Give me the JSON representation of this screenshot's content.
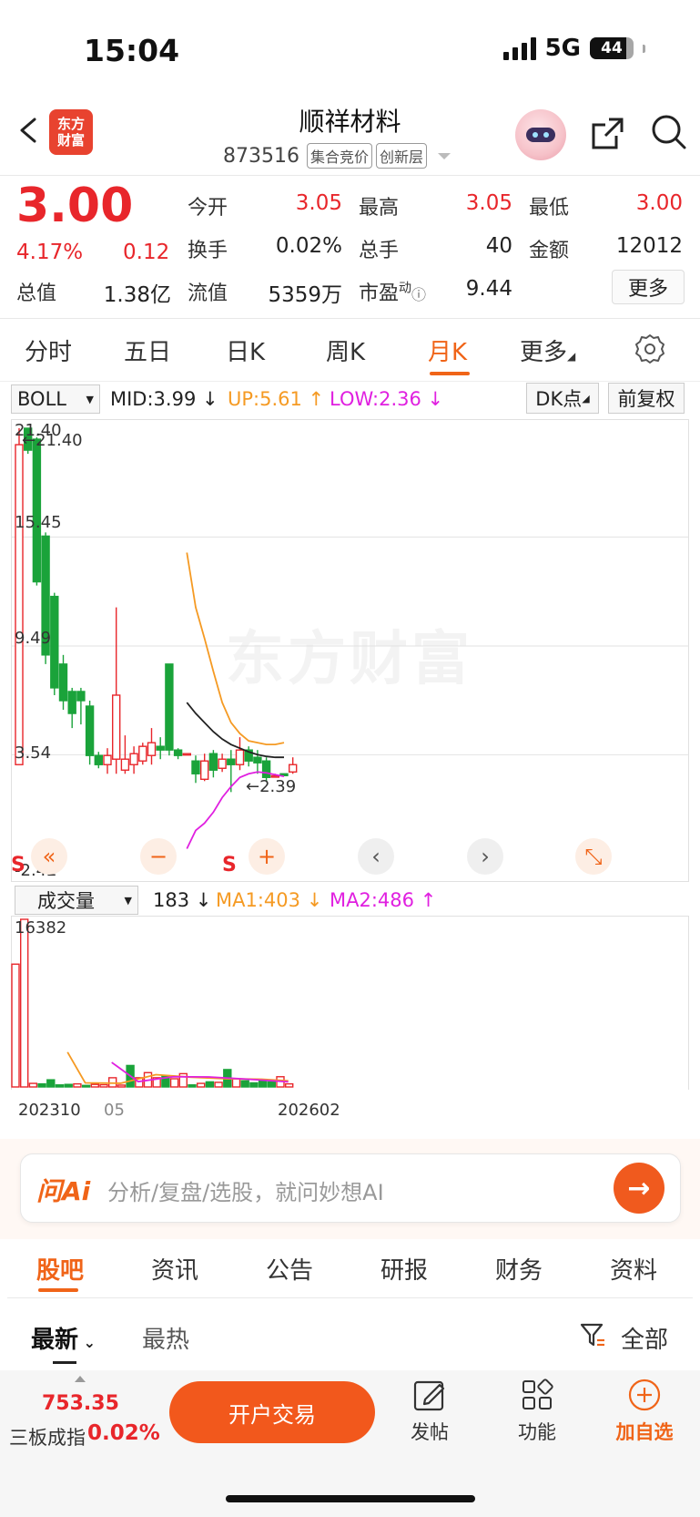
{
  "status_bar": {
    "time": "15:04",
    "network": "5G",
    "battery": "44"
  },
  "header": {
    "logo_line1": "东方",
    "logo_line2": "财富",
    "stock_name": "顺祥材料",
    "stock_code": "873516",
    "tags": [
      "集合竞价",
      "创新层"
    ]
  },
  "quote": {
    "price": "3.00",
    "change_pct": "4.17%",
    "change": "0.12",
    "fields": [
      {
        "label": "今开",
        "value": "3.05"
      },
      {
        "label": "最高",
        "value": "3.05"
      },
      {
        "label": "最低",
        "value": "3.00"
      },
      {
        "label": "换手",
        "value": "0.02%"
      },
      {
        "label": "总手",
        "value": "40"
      },
      {
        "label": "金额",
        "value": "12012"
      },
      {
        "label": "总值",
        "value": "1.38亿"
      },
      {
        "label": "流值",
        "value": "5359万"
      },
      {
        "label": "市盈",
        "superscript": "动",
        "value": "9.44"
      }
    ],
    "more_label": "更多"
  },
  "period_tabs": [
    "分时",
    "五日",
    "日K",
    "周K",
    "月K",
    "更多"
  ],
  "active_period": "月K",
  "boll_bar": {
    "selector": "BOLL",
    "mid": "MID:3.99",
    "up": "UP:5.61",
    "low": "LOW:2.36",
    "dk_label": "DK点",
    "fq_label": "前复权",
    "colors": {
      "mid": "#222222",
      "up": "#f59a23",
      "low": "#e020e0"
    }
  },
  "kline": {
    "y_labels": [
      "21.40",
      "15.45",
      "9.49",
      "3.54",
      "-2.42"
    ],
    "high_marker": "21.40",
    "low_marker": "2.39",
    "signal": "S",
    "watermark": "东方财富",
    "candles": [
      {
        "o": 3.0,
        "c": 20.5,
        "h": 21.4,
        "l": 3.0
      },
      {
        "o": 21.4,
        "c": 20.2,
        "h": 21.4,
        "l": 20.0
      },
      {
        "o": 20.8,
        "c": 13.0,
        "h": 20.9,
        "l": 12.8
      },
      {
        "o": 15.5,
        "c": 9.0,
        "h": 15.7,
        "l": 8.5
      },
      {
        "o": 12.2,
        "c": 7.2,
        "h": 12.4,
        "l": 6.8
      },
      {
        "o": 8.5,
        "c": 6.5,
        "h": 9.0,
        "l": 6.0
      },
      {
        "o": 7.0,
        "c": 5.8,
        "h": 7.2,
        "l": 5.0
      },
      {
        "o": 7.0,
        "c": 6.5,
        "h": 7.2,
        "l": 5.2
      },
      {
        "o": 6.2,
        "c": 3.5,
        "h": 6.5,
        "l": 3.0
      },
      {
        "o": 3.5,
        "c": 3.0,
        "h": 3.7,
        "l": 2.8
      },
      {
        "o": 3.0,
        "c": 3.5,
        "h": 3.9,
        "l": 2.5
      },
      {
        "o": 3.3,
        "c": 6.8,
        "h": 11.6,
        "l": 2.5
      },
      {
        "o": 2.7,
        "c": 3.3,
        "h": 4.6,
        "l": 2.5
      },
      {
        "o": 3.0,
        "c": 3.6,
        "h": 4.0,
        "l": 2.5
      },
      {
        "o": 3.2,
        "c": 4.0,
        "h": 4.2,
        "l": 3.0
      },
      {
        "o": 3.5,
        "c": 4.2,
        "h": 5.0,
        "l": 3.0
      },
      {
        "o": 4.0,
        "c": 3.8,
        "h": 4.5,
        "l": 3.3
      },
      {
        "o": 8.5,
        "c": 3.8,
        "h": 8.5,
        "l": 3.5
      },
      {
        "o": 3.8,
        "c": 3.5,
        "h": 3.9,
        "l": 3.3
      },
      {
        "o": 3.6,
        "c": 3.6,
        "h": 3.6,
        "l": 3.6
      },
      {
        "o": 3.2,
        "c": 2.5,
        "h": 3.5,
        "l": 2.0
      },
      {
        "o": 2.2,
        "c": 3.2,
        "h": 3.6,
        "l": 2.1
      },
      {
        "o": 3.6,
        "c": 2.7,
        "h": 3.8,
        "l": 2.3
      },
      {
        "o": 2.8,
        "c": 3.3,
        "h": 3.6,
        "l": 2.6
      },
      {
        "o": 3.3,
        "c": 3.0,
        "h": 3.8,
        "l": 1.5
      },
      {
        "o": 3.0,
        "c": 3.8,
        "h": 4.5,
        "l": 2.7
      },
      {
        "o": 3.8,
        "c": 3.2,
        "h": 4.0,
        "l": 2.9
      },
      {
        "o": 3.4,
        "c": 3.1,
        "h": 3.8,
        "l": 2.5
      },
      {
        "o": 3.2,
        "c": 2.3,
        "h": 3.4,
        "l": 2.1
      },
      {
        "o": 2.39,
        "c": 2.39,
        "h": 2.5,
        "l": 2.3
      },
      {
        "o": 2.5,
        "c": 2.4,
        "h": 2.5,
        "l": 2.39
      },
      {
        "o": 2.6,
        "c": 3.0,
        "h": 3.4,
        "l": 2.5
      }
    ],
    "boll_start_index": 19,
    "boll_up": [
      14.6,
      11.6,
      9.9,
      8.1,
      6.4,
      5.3,
      4.7,
      4.3,
      4.2,
      4.1,
      4.1,
      4.2
    ],
    "boll_mid": [
      6.4,
      5.8,
      5.3,
      4.8,
      4.4,
      4.1,
      3.9,
      3.7,
      3.55,
      3.45,
      3.4,
      3.4
    ],
    "boll_low": [
      -1.6,
      -0.6,
      -0.2,
      0.4,
      1.2,
      1.8,
      2.3,
      2.5,
      2.6,
      2.55,
      2.45,
      2.36
    ]
  },
  "chart_controls": [
    "«",
    "−",
    "+",
    "‹",
    "›",
    "⤡"
  ],
  "volume_bar": {
    "selector": "成交量",
    "value": "183",
    "ma1": "MA1:403",
    "ma2": "MA2:486",
    "max_label": "16382",
    "x_labels": [
      "202310",
      "05",
      "202602"
    ],
    "bars": [
      12000,
      16382,
      350,
      300,
      700,
      200,
      250,
      300,
      150,
      250,
      220,
      900,
      180,
      2100,
      900,
      1400,
      900,
      1100,
      800,
      1300,
      200,
      350,
      500,
      450,
      1700,
      800,
      600,
      400,
      600,
      500,
      1000,
      300
    ],
    "up": [
      true,
      true,
      true,
      false,
      false,
      false,
      false,
      true,
      false,
      true,
      true,
      true,
      true,
      false,
      true,
      true,
      true,
      false,
      true,
      true,
      false,
      true,
      false,
      true,
      false,
      true,
      false,
      false,
      false,
      false,
      true,
      true
    ]
  },
  "ai_box": {
    "logo": "问Ai",
    "placeholder": "分析/复盘/选股，就问妙想AI"
  },
  "bottom_tabs": [
    "股吧",
    "资讯",
    "公告",
    "研报",
    "财务",
    "资料"
  ],
  "sort_bar": {
    "latest": "最新",
    "hot": "最热",
    "filter": "全部"
  },
  "bottom_bar": {
    "index_value": "753.35",
    "index_name": "三板成指",
    "index_pct": "0.02%",
    "trade_button": "开户交易",
    "actions": [
      "发帖",
      "功能",
      "加自选"
    ]
  }
}
